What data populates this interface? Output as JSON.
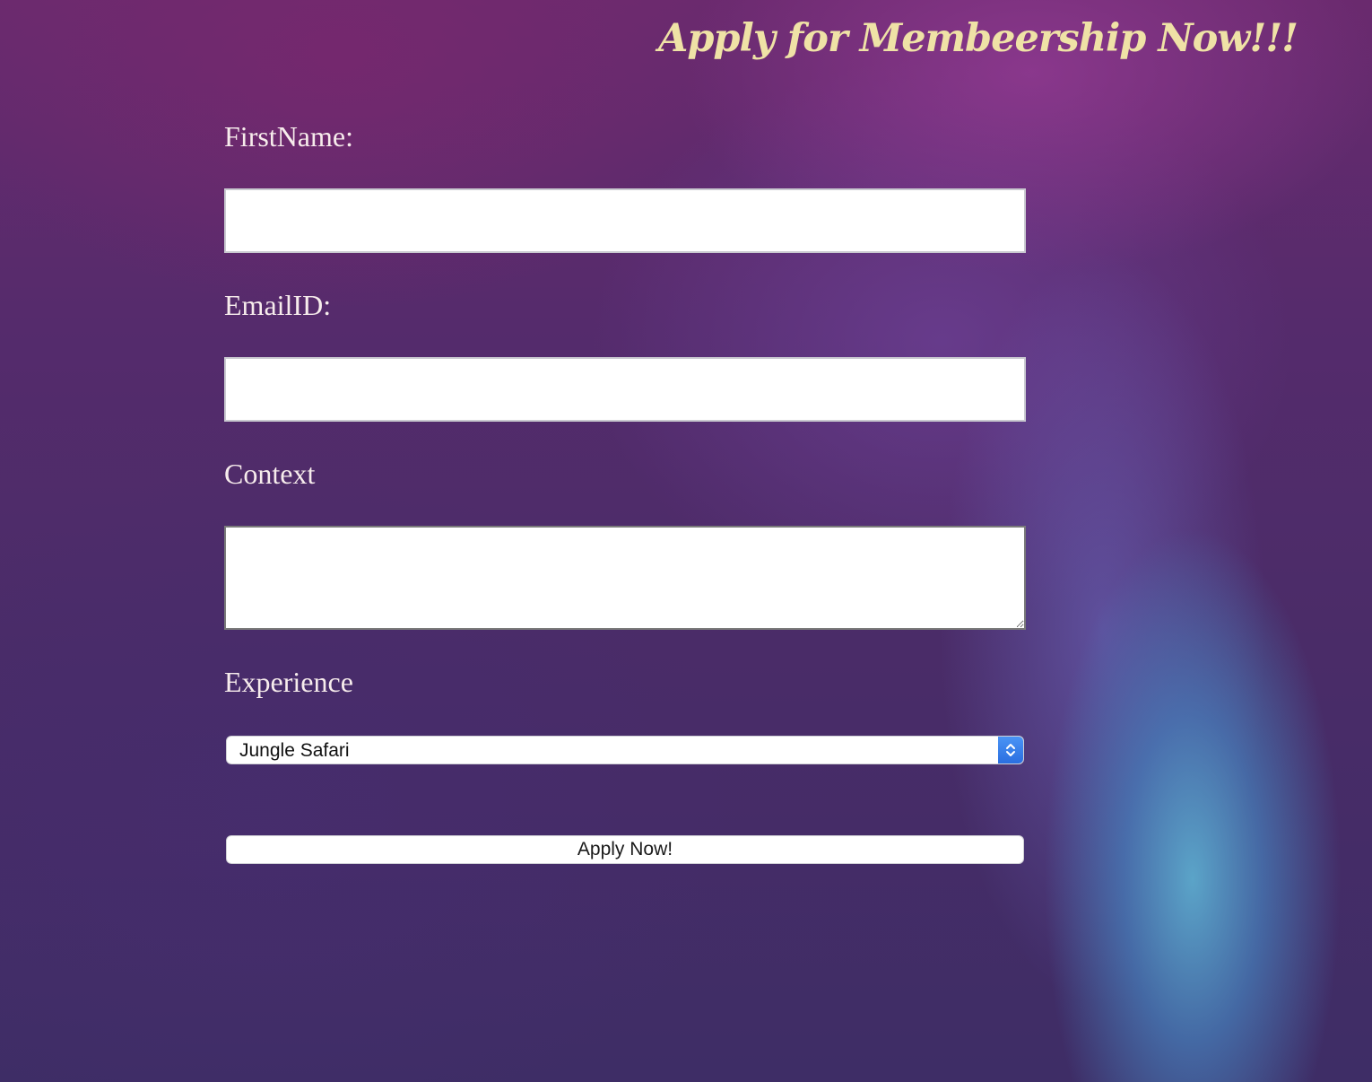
{
  "header": {
    "title": "Apply for Membeership Now!!!"
  },
  "form": {
    "first_name": {
      "label": "FirstName:",
      "value": ""
    },
    "email": {
      "label": "EmailID:",
      "value": ""
    },
    "context": {
      "label": "Context",
      "value": ""
    },
    "experience": {
      "label": "Experience",
      "selected": "Jungle Safari"
    },
    "submit_label": "Apply Now!"
  },
  "colors": {
    "title": "#efe2a6",
    "label": "#f7ecec",
    "select_accent": "#2a6ee0"
  },
  "icons": {
    "select_arrows": "chevron-up-down-icon",
    "resize_handle": "resize-grip-icon"
  }
}
